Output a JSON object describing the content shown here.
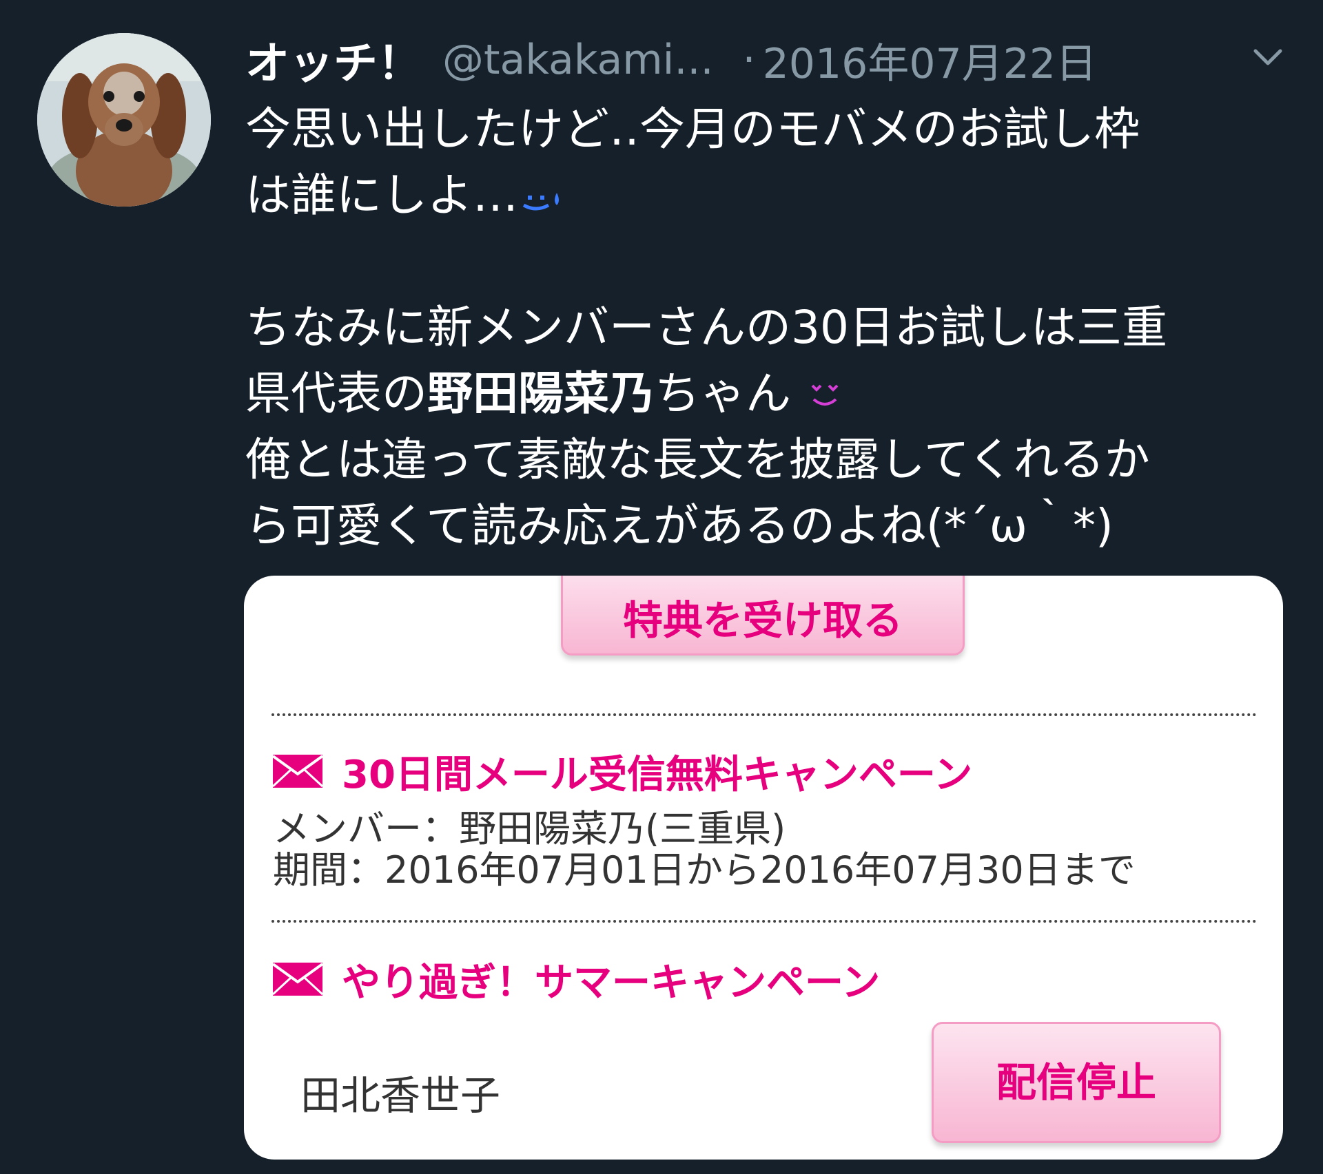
{
  "tweet": {
    "display_name": "オッチ！",
    "handle": "@takakami...",
    "separator": "·",
    "date": "2016年07月22日",
    "icons": {
      "avatar": "dog-avatar",
      "more": "chevron-down-icon",
      "emoji_sweat": "sweat-smile-emoji",
      "emoji_love": "heart-eyes-emoji"
    },
    "text": {
      "line1": "今思い出したけど‥今月のモバメのお試し枠",
      "line2": "は誰にしよ…",
      "line3": "ちなみに新メンバーさんの30日お試しは三重",
      "line4_prefix": "県代表の",
      "line4_bold": "野田陽菜乃",
      "line4_suffix": "ちゃん",
      "line5": "俺とは違って素敵な長文を披露してくれるか",
      "line6": "ら可愛くて読み応えがあるのよね(*´ω｀*)"
    }
  },
  "card": {
    "accent_color": "#e6007e",
    "receive_button": "特典を受け取る",
    "campaign1": {
      "title": "30日間メール受信無料キャンペーン",
      "member": "メンバー：野田陽菜乃(三重県)",
      "period": "期間：2016年07月01日から2016年07月30日まで"
    },
    "campaign2": {
      "title": "やり過ぎ！サマーキャンペーン",
      "member_name": "田北香世子",
      "stop_button": "配信停止"
    },
    "icons": {
      "mail": "envelope-icon"
    }
  }
}
